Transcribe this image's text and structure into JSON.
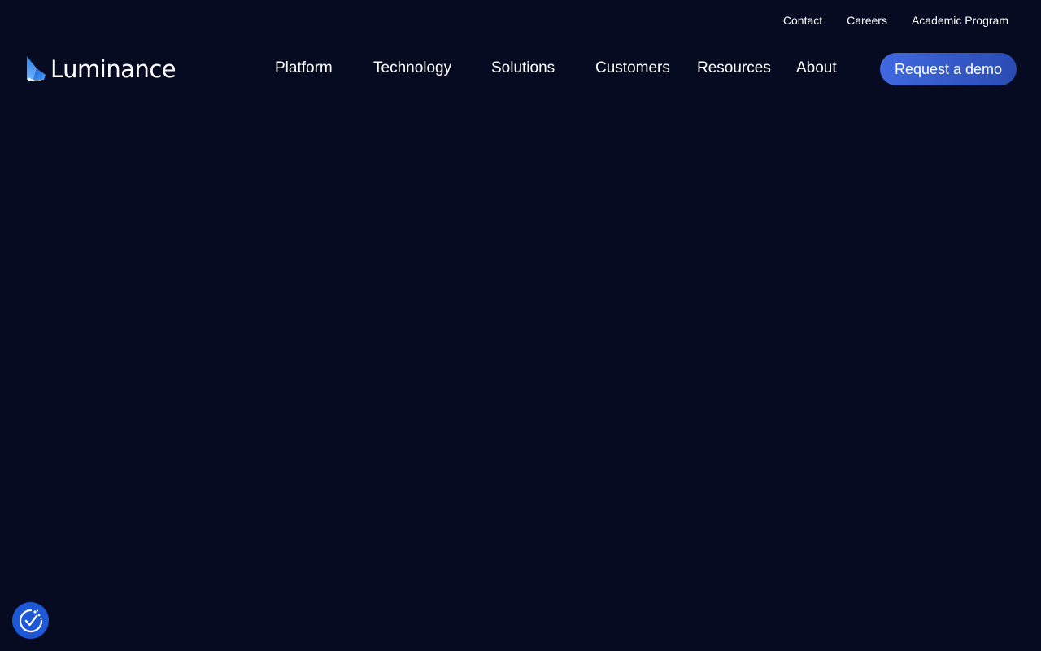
{
  "utility_nav": {
    "items": [
      {
        "label": "Contact"
      },
      {
        "label": "Careers"
      },
      {
        "label": "Academic Program"
      }
    ]
  },
  "brand": {
    "name": "Luminance"
  },
  "main_nav": {
    "items": [
      {
        "label": "Platform"
      },
      {
        "label": "Technology"
      },
      {
        "label": "Solutions"
      },
      {
        "label": "Customers"
      },
      {
        "label": "Resources"
      },
      {
        "label": "About"
      }
    ]
  },
  "cta": {
    "label": "Request a demo"
  },
  "consent": {
    "icon": "cookie-consent-icon"
  },
  "colors": {
    "background": "#070b22",
    "accent": "#4069e0",
    "consent": "#1d58d6"
  }
}
